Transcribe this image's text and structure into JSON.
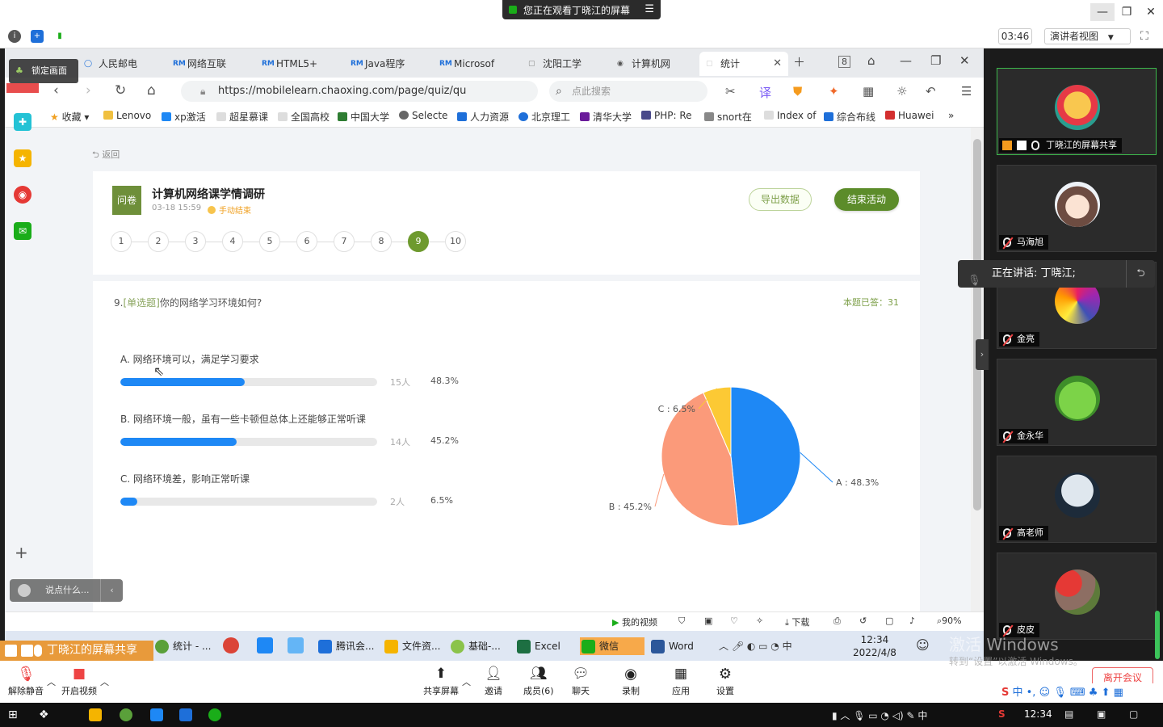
{
  "meeting": {
    "share_banner": "您正在观看丁晓江的屏幕",
    "timer": "03:46",
    "presenter_view": "演讲者视图",
    "lock_screen": "锁定画面",
    "chat_placeholder": "说点什么...",
    "sharing_label": "丁晓江的屏幕共享",
    "speaking_now": "正在讲话: 丁晓江;",
    "leave": "离开会议",
    "activate_title": "激活 Windows",
    "activate_sub": "转到“设置”以激活 Windows。"
  },
  "browser": {
    "tabs": [
      {
        "label": "人民邮电"
      },
      {
        "label": "网络互联"
      },
      {
        "label": "HTML5+"
      },
      {
        "label": "Java程序"
      },
      {
        "label": "Microsof"
      },
      {
        "label": "沈阳工学"
      },
      {
        "label": "计算机网"
      },
      {
        "label": "统计"
      }
    ],
    "url": "https://mobilelearn.chaoxing.com/page/quiz/qu",
    "search_placeholder": "点此搜索",
    "bookmarks": [
      "收藏",
      "Lenovo",
      "xp激活",
      "超星慕课",
      "全国高校",
      "中国大学",
      "Selecte",
      "人力资源",
      "北京理工",
      "清华大学",
      "PHP: Re",
      "snort在",
      "Index of",
      "综合布线",
      "Huawei"
    ],
    "status": {
      "my_video": "我的视频",
      "download": "下载",
      "zoom": "90%"
    }
  },
  "quiz": {
    "back": "返回",
    "badge": "问卷",
    "title": "计算机网络课学情调研",
    "date": "03-18 15:59",
    "status": "手动结束",
    "export_label": "导出数据",
    "end_label": "结束活动",
    "question_numbers": [
      "1",
      "2",
      "3",
      "4",
      "5",
      "6",
      "7",
      "8",
      "9",
      "10"
    ],
    "active_question": "9",
    "question_prefix": "9.",
    "question_type": "[单选题]",
    "question_text": "你的网络学习环境如何?",
    "answered": "本题已答：31",
    "options": [
      {
        "label": "A. 网络环境可以，满足学习要求",
        "count": "15人",
        "percent": "48.3%",
        "fraction": 0.483
      },
      {
        "label": "B. 网络环境一般，虽有一些卡顿但总体上还能够正常听课",
        "count": "14人",
        "percent": "45.2%",
        "fraction": 0.452
      },
      {
        "label": "C. 网络环境差，影响正常听课",
        "count": "2人",
        "percent": "6.5%",
        "fraction": 0.065
      }
    ]
  },
  "chart_data": {
    "type": "pie",
    "categories": [
      "A",
      "B",
      "C"
    ],
    "values": [
      48.3,
      45.2,
      6.5
    ],
    "labels": [
      "A : 48.3%",
      "B : 45.2%",
      "C : 6.5%"
    ],
    "colors": [
      "#1e88f5",
      "#fb9a7a",
      "#fcc934"
    ]
  },
  "participants": [
    {
      "name": "丁晓江的屏幕共享",
      "speaking": true
    },
    {
      "name": "马海旭"
    },
    {
      "name": "金亮"
    },
    {
      "name": "金永华"
    },
    {
      "name": "高老师"
    },
    {
      "name": "皮皮"
    }
  ],
  "shared_taskbar": {
    "items": [
      "统计 - ...",
      "腾讯会...",
      "文件资...",
      "基础-...",
      "Excel",
      "微信",
      "Word"
    ],
    "time": "12:34",
    "date": "2022/4/8"
  },
  "bottom_bar": {
    "unmute": "解除静音",
    "start_video": "开启视频",
    "share_screen": "共享屏幕",
    "invite": "邀请",
    "members": "成员(6)",
    "chat": "聊天",
    "record": "录制",
    "apps": "应用",
    "settings": "设置"
  },
  "taskbar": {
    "time": "12:34"
  }
}
